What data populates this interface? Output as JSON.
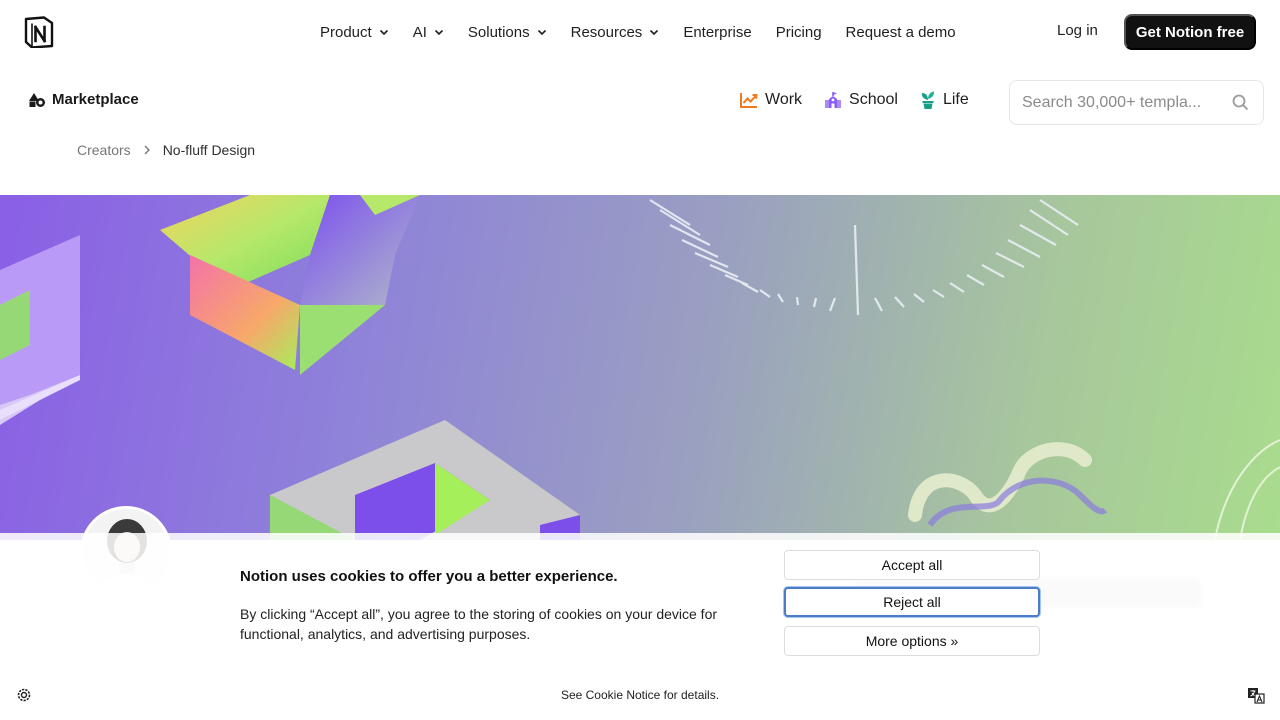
{
  "nav": {
    "logo": "notion-logo",
    "items": [
      {
        "label": "Product",
        "dropdown": true
      },
      {
        "label": "AI",
        "dropdown": true
      },
      {
        "label": "Solutions",
        "dropdown": true
      },
      {
        "label": "Resources",
        "dropdown": true
      },
      {
        "label": "Enterprise",
        "dropdown": false
      },
      {
        "label": "Pricing",
        "dropdown": false
      },
      {
        "label": "Request a demo",
        "dropdown": false
      }
    ],
    "login": "Log in",
    "cta": "Get Notion free"
  },
  "marketplace": {
    "label": "Marketplace",
    "categories": [
      {
        "label": "Work",
        "icon": "chart-up-icon",
        "color": "#f07a1e"
      },
      {
        "label": "School",
        "icon": "school-building-icon",
        "color": "#8b5cf6"
      },
      {
        "label": "Life",
        "icon": "plant-pot-icon",
        "color": "#169e8a"
      }
    ],
    "search_placeholder": "Search 30,000+ templa..."
  },
  "breadcrumb": {
    "items": [
      "Creators",
      "No-fluff Design"
    ]
  },
  "cookie": {
    "title": "Notion uses cookies to offer you a better experience.",
    "body": "By clicking “Accept all”, you agree to the storing of cookies on your device for functional, analytics, and advertising purposes.",
    "accept": "Accept all",
    "reject": "Reject all",
    "more": "More options »",
    "notice": "See Cookie Notice for details."
  },
  "colors": {
    "cta_bg": "#111111",
    "focus_ring": "#4a7cc9"
  }
}
